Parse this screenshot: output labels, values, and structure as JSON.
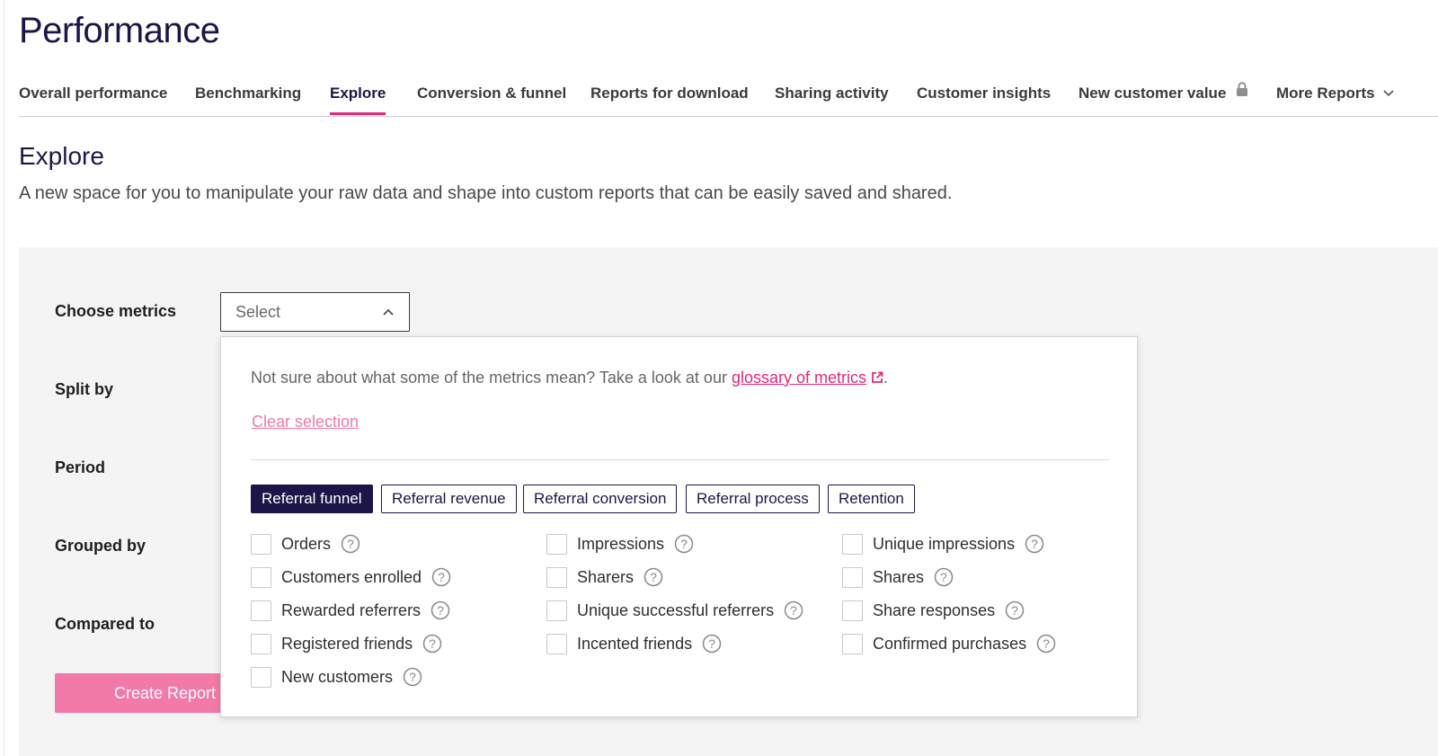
{
  "page": {
    "title": "Performance"
  },
  "tabs": [
    {
      "label": "Overall performance"
    },
    {
      "label": "Benchmarking"
    },
    {
      "label": "Explore"
    },
    {
      "label": "Conversion & funnel"
    },
    {
      "label": "Reports for download"
    },
    {
      "label": "Sharing activity"
    },
    {
      "label": "Customer insights"
    },
    {
      "label": "New customer value",
      "icon": "lock-icon"
    },
    {
      "label": "More Reports",
      "icon": "chevron-down-icon"
    }
  ],
  "active_tab": "Explore",
  "section": {
    "title": "Explore",
    "description": "A new space for you to manipulate your raw data and shape into custom reports that can be easily saved and shared."
  },
  "form": {
    "choose_metrics_label": "Choose metrics",
    "split_by_label": "Split by",
    "period_label": "Period",
    "grouped_by_label": "Grouped by",
    "compared_to_label": "Compared to",
    "select_placeholder": "Select",
    "create_button": "Create Report"
  },
  "dropdown": {
    "hint_prefix": "Not sure about what some of the metrics mean? Take a look at our ",
    "glossary_link": "glossary of metrics",
    "hint_suffix": ".",
    "clear_selection": "Clear selection",
    "categories": [
      {
        "label": "Referral funnel",
        "selected": true
      },
      {
        "label": "Referral revenue",
        "selected": false
      },
      {
        "label": "Referral conversion",
        "selected": false
      },
      {
        "label": "Referral process",
        "selected": false
      },
      {
        "label": "Retention",
        "selected": false
      }
    ],
    "metrics": [
      [
        "Orders",
        "Customers enrolled",
        "Rewarded referrers",
        "Registered friends",
        "New customers"
      ],
      [
        "Impressions",
        "Sharers",
        "Unique successful referrers",
        "Incented friends"
      ],
      [
        "Unique impressions",
        "Shares",
        "Share responses",
        "Confirmed purchases"
      ]
    ]
  },
  "colors": {
    "brand_navy": "#1c1648",
    "accent_pink": "#e3287b",
    "button_pink": "#f17aa8",
    "panel_gray": "#f4f4f4"
  }
}
